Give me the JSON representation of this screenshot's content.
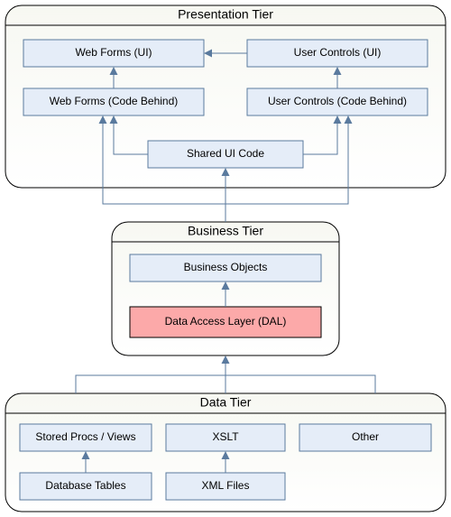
{
  "tiers": {
    "presentation": {
      "title": "Presentation Tier"
    },
    "business": {
      "title": "Business Tier"
    },
    "data": {
      "title": "Data Tier"
    }
  },
  "boxes": {
    "web_forms_ui": "Web Forms (UI)",
    "user_controls_ui": "User Controls (UI)",
    "web_forms_cb": "Web Forms (Code Behind)",
    "user_controls_cb": "User Controls (Code Behind)",
    "shared_ui": "Shared UI Code",
    "business_objects": "Business Objects",
    "dal": "Data Access Layer (DAL)",
    "stored_procs": "Stored Procs / Views",
    "xslt": "XSLT",
    "other": "Other",
    "db_tables": "Database Tables",
    "xml_files": "XML Files"
  },
  "colors": {
    "box_fill": "#e5edf8",
    "box_stroke": "#5a7a9e",
    "highlight_fill": "#fca9a9",
    "arrow": "#5a7a9e"
  }
}
